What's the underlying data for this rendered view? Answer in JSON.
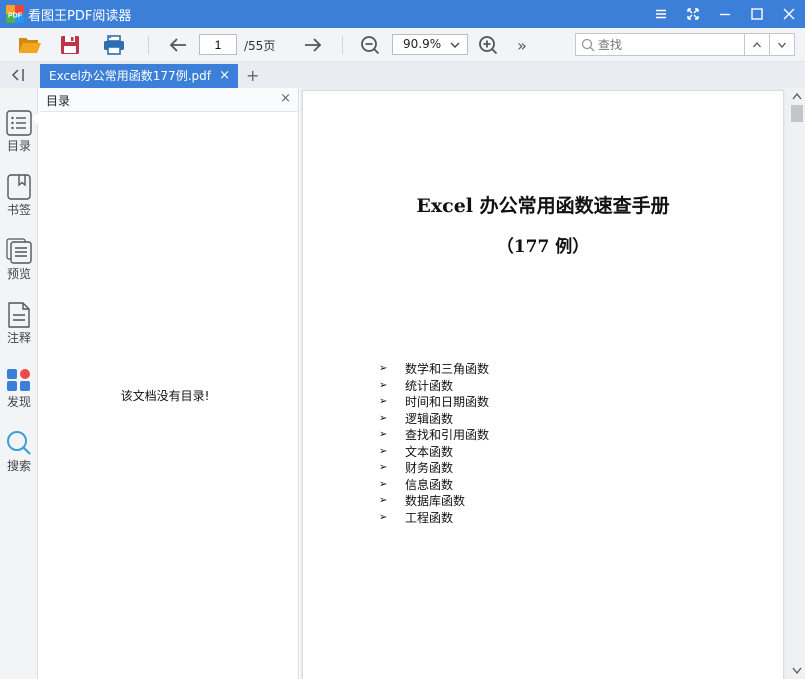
{
  "window": {
    "title": "看图王PDF阅读器",
    "logo_text": "PDF"
  },
  "toolbar": {
    "current_page": "1",
    "page_total": "/55页",
    "zoom": "90.9%",
    "search_placeholder": "查找",
    "more": "»"
  },
  "tabs": {
    "active_label": "Excel办公常用函数177例.pdf",
    "close": "×",
    "add": "+"
  },
  "rail": {
    "items": [
      {
        "label": "目录",
        "icon": "toc-icon"
      },
      {
        "label": "书签",
        "icon": "bookmark-icon"
      },
      {
        "label": "预览",
        "icon": "preview-icon"
      },
      {
        "label": "注释",
        "icon": "annotation-icon"
      },
      {
        "label": "发现",
        "icon": "discover-icon"
      },
      {
        "label": "搜索",
        "icon": "search-icon"
      }
    ]
  },
  "panel": {
    "title": "目录",
    "close": "×",
    "empty_message": "该文档没有目录!"
  },
  "document": {
    "title": "Excel 办公常用函数速查手册",
    "subtitle": "（177 例）",
    "bullet": "➢",
    "toc": [
      "数学和三角函数",
      "统计函数",
      "时间和日期函数",
      "逻辑函数",
      "查找和引用函数",
      "文本函数",
      "财务函数",
      "信息函数",
      "数据库函数",
      "工程函数"
    ]
  },
  "colors": {
    "accent": "#3c7fd8",
    "folder": "#f2a61d",
    "save": "#c0344a",
    "print": "#2f6db3",
    "discover_dot": "#ef4a4a"
  }
}
